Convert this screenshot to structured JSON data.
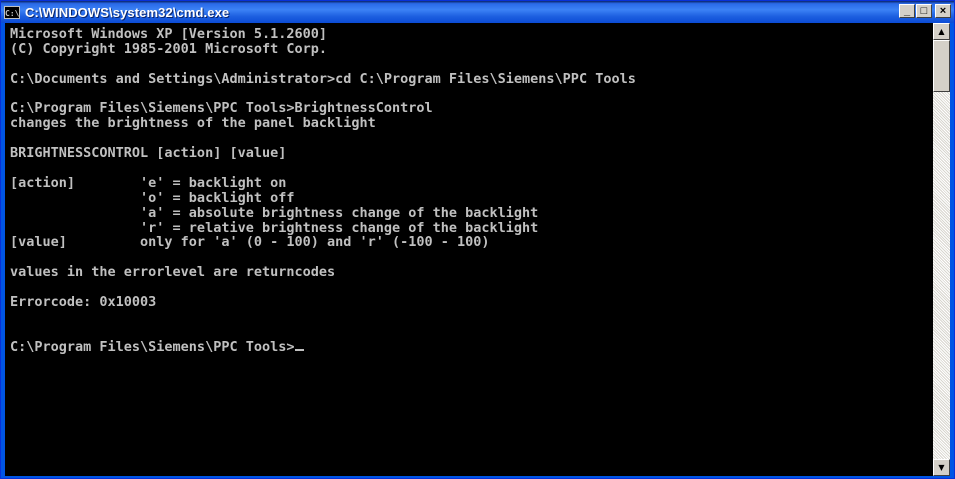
{
  "window": {
    "title": "C:\\WINDOWS\\system32\\cmd.exe",
    "icon_text": "C:\\",
    "minimize_glyph": "_",
    "maximize_glyph": "□",
    "close_glyph": "×"
  },
  "console": {
    "lines": [
      "Microsoft Windows XP [Version 5.1.2600]",
      "(C) Copyright 1985-2001 Microsoft Corp.",
      "",
      "C:\\Documents and Settings\\Administrator>cd C:\\Program Files\\Siemens\\PPC Tools",
      "",
      "C:\\Program Files\\Siemens\\PPC Tools>BrightnessControl",
      "changes the brightness of the panel backlight",
      "",
      "BRIGHTNESSCONTROL [action] [value]",
      "",
      "[action]        'e' = backlight on",
      "                'o' = backlight off",
      "                'a' = absolute brightness change of the backlight",
      "                'r' = relative brightness change of the backlight",
      "[value]         only for 'a' (0 - 100) and 'r' (-100 - 100)",
      "",
      "values in the errorlevel are returncodes",
      "",
      "Errorcode: 0x10003",
      "",
      "",
      "C:\\Program Files\\Siemens\\PPC Tools>"
    ]
  },
  "scrollbar": {
    "up_arrow": "▲",
    "down_arrow": "▼"
  },
  "colors": {
    "console_bg": "#000000",
    "console_text": "#c0c0c0",
    "titlebar": "#0a4fd8"
  }
}
